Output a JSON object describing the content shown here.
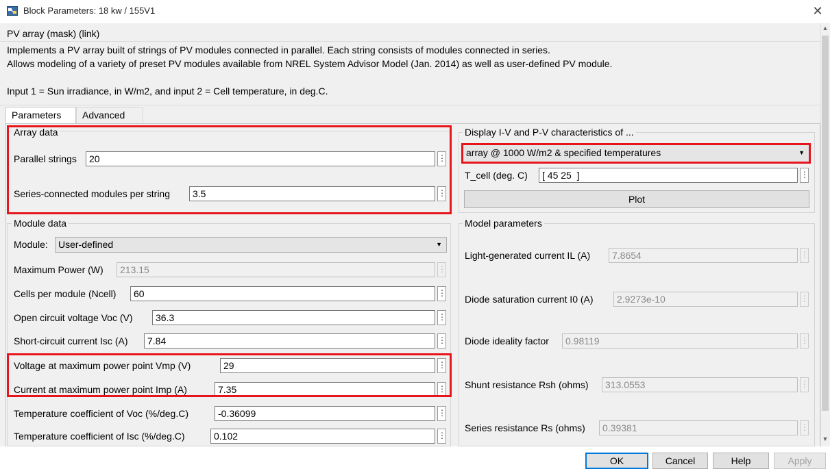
{
  "window": {
    "title": "Block Parameters: 18 kw / 155V1",
    "close_glyph": "✕"
  },
  "mask": {
    "title": "PV array (mask) (link)",
    "description_line1": "Implements a PV array built of strings of PV modules connected in parallel. Each string consists of modules connected in series.",
    "description_line2": "Allows modeling of a variety of preset PV modules available from NREL System Advisor Model (Jan. 2014) as well as user-defined PV module.",
    "description_line3": "Input 1 = Sun irradiance, in W/m2, and input 2 = Cell temperature, in deg.C."
  },
  "tabs": [
    {
      "label": "Parameters",
      "active": true
    },
    {
      "label": "Advanced",
      "active": false
    }
  ],
  "array_data": {
    "title": "Array data",
    "parallel_strings_label": "Parallel strings",
    "parallel_strings_value": "20",
    "series_modules_label": "Series-connected modules per string",
    "series_modules_value": "3.5"
  },
  "module_data": {
    "title": "Module data",
    "module_label": "Module:",
    "module_value": "User-defined",
    "fields": [
      {
        "label": "Maximum Power (W)",
        "value": "213.15",
        "disabled": true
      },
      {
        "label": "Cells per module (Ncell)",
        "value": "60",
        "disabled": false
      },
      {
        "label": "Open circuit voltage  Voc (V)",
        "value": "36.3",
        "disabled": false
      },
      {
        "label": "Short-circuit current Isc (A)",
        "value": "7.84",
        "disabled": false
      },
      {
        "label": "Voltage at maximum power point Vmp (V)",
        "value": "29",
        "disabled": false
      },
      {
        "label": "Current at maximum power point Imp (A)",
        "value": "7.35",
        "disabled": false
      },
      {
        "label": "Temperature coefficient of Voc (%/deg.C)",
        "value": "-0.36099",
        "disabled": false
      },
      {
        "label": "Temperature coefficient of Isc (%/deg.C)",
        "value": "0.102",
        "disabled": false
      }
    ]
  },
  "display": {
    "title": "Display  I-V and P-V characteristics of ...",
    "selection": "array @ 1000 W/m2 & specified temperatures",
    "tcell_label": "T_cell (deg. C)",
    "tcell_value": "[ 45 25  ]",
    "plot_label": "Plot"
  },
  "model_parameters": {
    "title": "Model parameters",
    "fields": [
      {
        "label": "Light-generated current IL (A)",
        "value": "7.8654"
      },
      {
        "label": "Diode saturation current I0 (A)",
        "value": "2.9273e-10"
      },
      {
        "label": "Diode ideality factor",
        "value": "0.98119"
      },
      {
        "label": "Shunt resistance Rsh (ohms)",
        "value": "313.0553"
      },
      {
        "label": "Series resistance Rs (ohms)",
        "value": "0.39381"
      }
    ]
  },
  "buttons": {
    "ok": "OK",
    "cancel": "Cancel",
    "help": "Help",
    "apply": "Apply"
  },
  "glyphs": {
    "dots": "⋮",
    "dropdown_arrow": "▼",
    "scroll_up": "▲",
    "scroll_down": "▼"
  },
  "colors": {
    "highlight": "#e8141c",
    "default_button_border": "#0078d7"
  }
}
